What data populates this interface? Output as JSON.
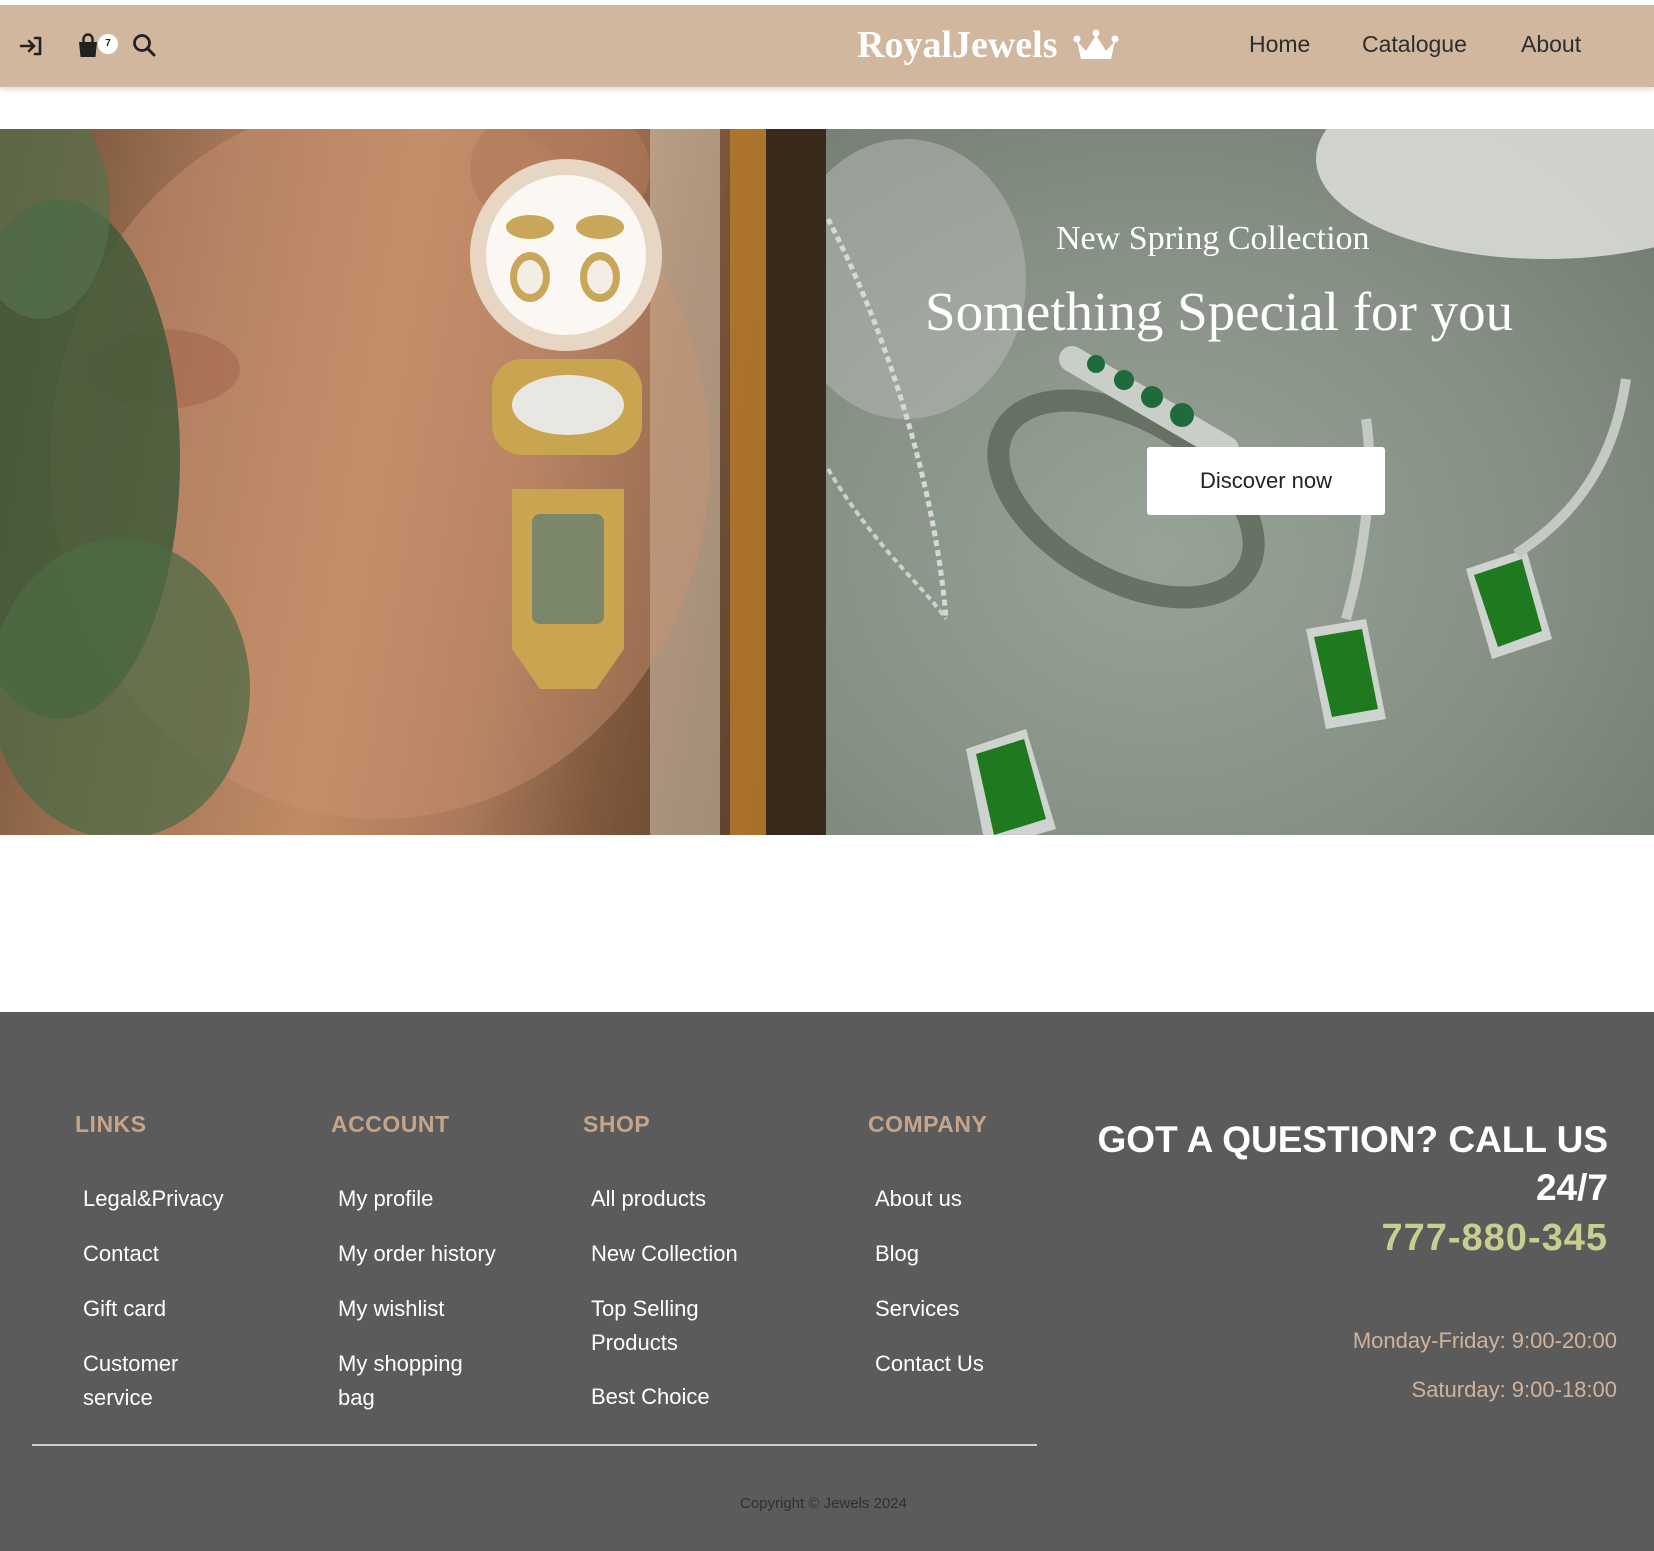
{
  "header": {
    "brand": "RoyalJewels",
    "cart_count": "7",
    "nav": [
      "Home",
      "Catalogue",
      "About"
    ],
    "icons": [
      "login-icon",
      "shopping-bag-icon",
      "search-icon",
      "crown-icon"
    ]
  },
  "hero": {
    "subtitle": "New Spring Collection",
    "title": "Something Special for you",
    "cta": "Discover now"
  },
  "footer": {
    "columns": [
      {
        "heading": "LINKS",
        "items": [
          "Legal&Privacy",
          "Contact",
          "Gift card",
          "Customer service"
        ]
      },
      {
        "heading": "ACCOUNT",
        "items": [
          "My profile",
          "My order history",
          "My wishlist",
          "My shopping bag"
        ]
      },
      {
        "heading": "SHOP",
        "items": [
          "All products",
          "New Collection",
          "Top Selling Products",
          "Best Choice"
        ]
      },
      {
        "heading": "COMPANY",
        "items": [
          "About us",
          "Blog",
          "Services",
          "Contact Us"
        ]
      }
    ],
    "question_line1": "GOT A QUESTION? CALL US",
    "question_line2": "24/7",
    "phone": "777-880-345",
    "hours_weekday": "Monday-Friday: 9:00-20:00",
    "hours_saturday": "Saturday: 9:00-18:00",
    "copyright": "Copyright © Jewels 2024"
  },
  "colors": {
    "header_bg": "#d1b79d",
    "footer_bg": "#5c5b5c",
    "footer_heading": "#c5a58a",
    "phone": "#c8cf8e"
  }
}
